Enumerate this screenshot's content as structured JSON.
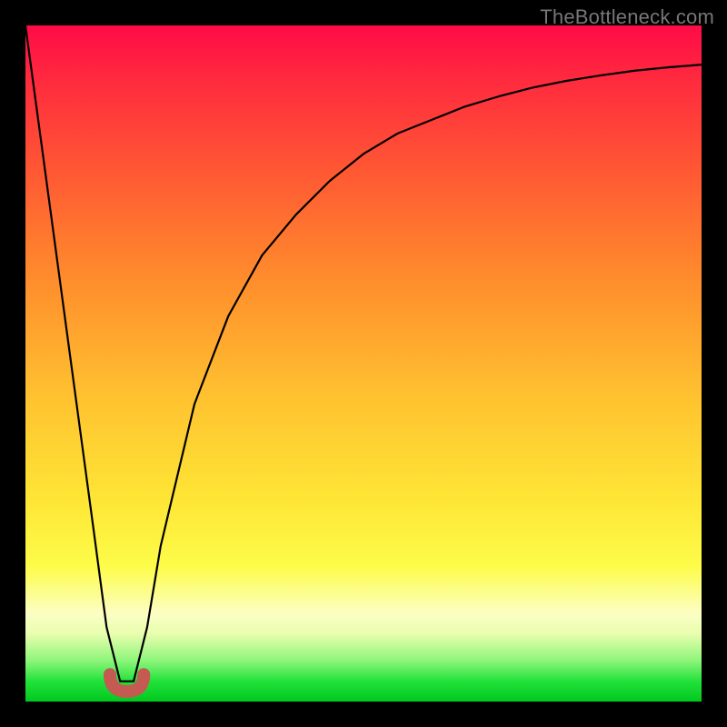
{
  "watermark": "TheBottleneck.com",
  "chart_data": {
    "type": "line",
    "title": "",
    "xlabel": "",
    "ylabel": "",
    "xlim": [
      0,
      100
    ],
    "ylim": [
      0,
      100
    ],
    "grid": false,
    "legend": false,
    "series": [
      {
        "name": "bottleneck-curve",
        "x": [
          0,
          5,
          10,
          12,
          14,
          16,
          18,
          20,
          25,
          30,
          35,
          40,
          45,
          50,
          55,
          60,
          65,
          70,
          75,
          80,
          85,
          90,
          95,
          100
        ],
        "y": [
          100,
          63,
          26,
          11,
          3,
          3,
          11,
          23,
          44,
          57,
          66,
          72,
          77,
          81,
          84,
          86,
          88,
          89.5,
          90.8,
          91.8,
          92.6,
          93.3,
          93.8,
          94.2
        ]
      }
    ],
    "marker": {
      "name": "optimal-range",
      "x_range": [
        12.5,
        17.5
      ],
      "y": 1.5,
      "color": "#c45a52"
    },
    "background_gradient": {
      "top": "#ff0b47",
      "mid_upper": "#ff8e2c",
      "mid": "#fee535",
      "mid_lower": "#fcfec4",
      "bottom": "#00c81e"
    }
  }
}
